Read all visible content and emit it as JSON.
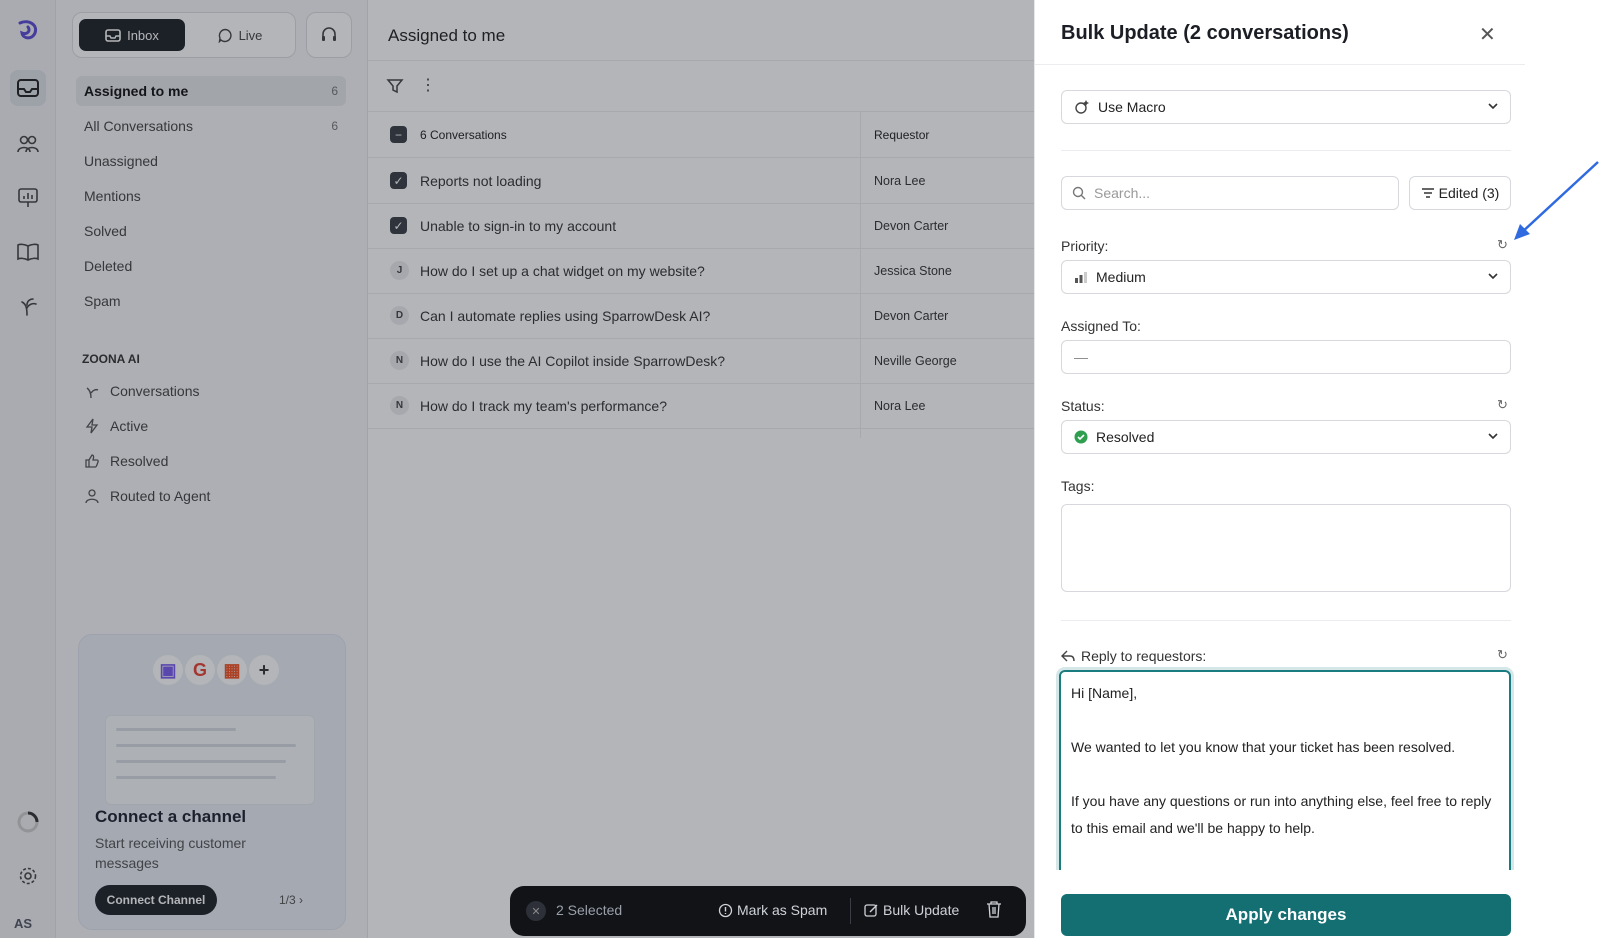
{
  "rail": {
    "avatar_initials": "AS"
  },
  "sidebar": {
    "tab_inbox": "Inbox",
    "tab_live": "Live",
    "items": [
      {
        "label": "Assigned to me",
        "count": "6"
      },
      {
        "label": "All Conversations",
        "count": "6"
      },
      {
        "label": "Unassigned",
        "count": ""
      },
      {
        "label": "Mentions",
        "count": ""
      },
      {
        "label": "Solved",
        "count": ""
      },
      {
        "label": "Deleted",
        "count": ""
      },
      {
        "label": "Spam",
        "count": ""
      }
    ],
    "ai_section_title": "ZOONA AI",
    "ai_items": [
      {
        "label": "Conversations",
        "icon": "sprout-icon"
      },
      {
        "label": "Active",
        "icon": "bolt-icon"
      },
      {
        "label": "Resolved",
        "icon": "thumbs-up-icon"
      },
      {
        "label": "Routed to Agent",
        "icon": "person-icon"
      }
    ],
    "promo": {
      "title": "Connect a channel",
      "subtitle": "Start receiving customer messages",
      "button": "Connect Channel",
      "pager": "1/3"
    }
  },
  "main": {
    "title": "Assigned to me",
    "header_count": "6 Conversations",
    "header_requestor": "Requestor",
    "rows": [
      {
        "marker": "checked",
        "subject": "Reports not loading",
        "requestor": "Nora Lee"
      },
      {
        "marker": "checked",
        "subject": "Unable to sign-in to my account",
        "requestor": "Devon Carter"
      },
      {
        "marker": "J",
        "subject": "How do I set up a chat widget on my website?",
        "requestor": "Jessica Stone"
      },
      {
        "marker": "D",
        "subject": "Can I automate replies using SparrowDesk AI?",
        "requestor": "Devon Carter"
      },
      {
        "marker": "N",
        "subject": "How do I use the AI Copilot inside SparrowDesk?",
        "requestor": "Neville George"
      },
      {
        "marker": "N",
        "subject": "How do I track my team's performance?",
        "requestor": "Nora Lee"
      }
    ]
  },
  "action_bar": {
    "selected": "2 Selected",
    "mark_spam": "Mark as Spam",
    "bulk_update": "Bulk Update"
  },
  "drawer": {
    "title": "Bulk Update (2 conversations)",
    "macro": "Use Macro",
    "search_placeholder": "Search...",
    "edited": "Edited (3)",
    "priority_label": "Priority:",
    "priority_value": "Medium",
    "assigned_label": "Assigned To:",
    "assigned_value": "—",
    "status_label": "Status:",
    "status_value": "Resolved",
    "status_color": "#2e9e4f",
    "tags_label": "Tags:",
    "reply_label": "Reply to requestors:",
    "reply_lines": [
      "Hi [Name],",
      "",
      "We wanted to let you know that your ticket has been resolved.",
      "",
      "If you have any questions or run into anything else, feel free to reply to this email and we'll be happy to help."
    ],
    "apply": "Apply changes",
    "accent": "#136f72"
  }
}
